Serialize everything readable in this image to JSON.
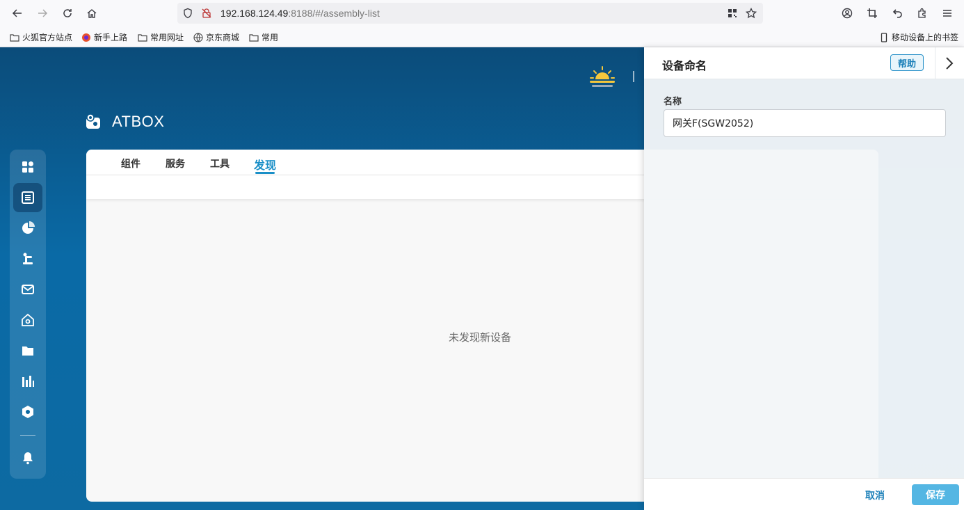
{
  "browser": {
    "url_host": "192.168.124.49",
    "url_rest": ":8188/#/assembly-list",
    "bookmarks": [
      "火狐官方站点",
      "新手上路",
      "常用网址",
      "京东商城",
      "常用"
    ],
    "mobile_bookmarks": "移动设备上的书签"
  },
  "app": {
    "brand": "ATBOX",
    "tabs": [
      "组件",
      "服务",
      "工具",
      "发现"
    ],
    "active_tab": "发现",
    "empty_message": "未发现新设备",
    "accent_color": "#1a8fc7"
  },
  "drawer": {
    "title": "设备命名",
    "help_label": "帮助",
    "field_label": "名称",
    "field_value": "网关F(SGW2052)",
    "cancel_label": "取消",
    "save_label": "保存"
  }
}
